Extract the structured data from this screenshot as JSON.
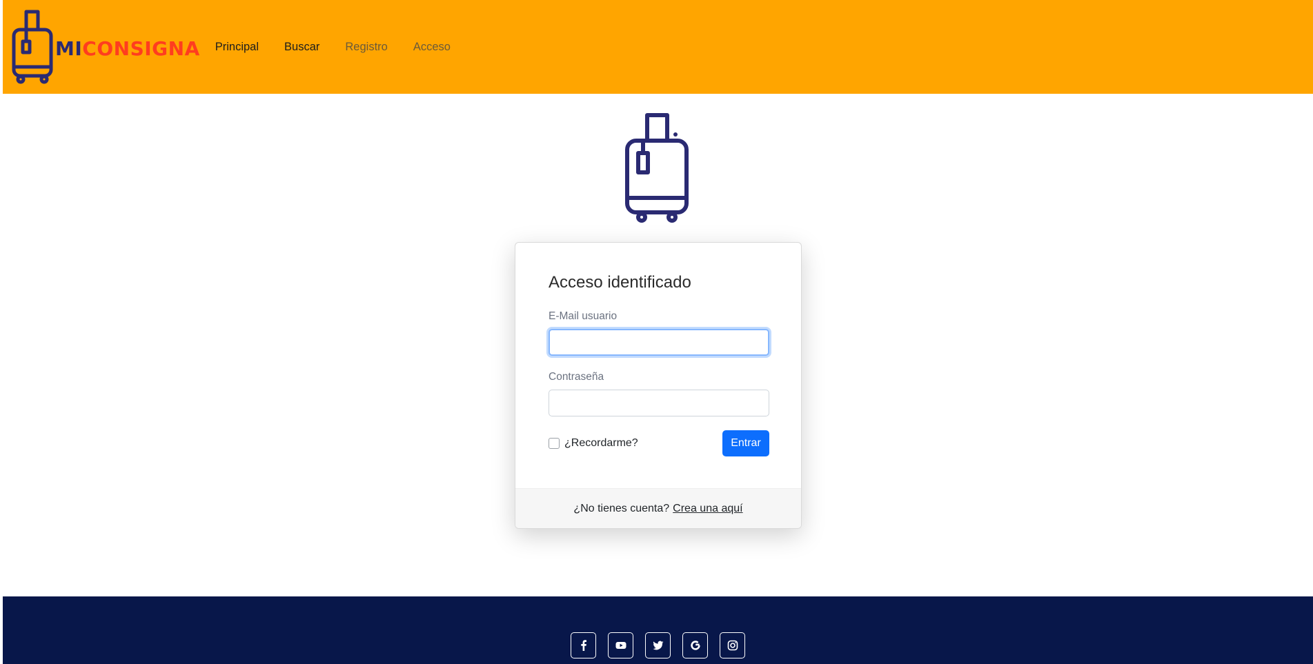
{
  "brand": {
    "prefix": "MI",
    "name": "CONSIGNA"
  },
  "nav": {
    "items": [
      {
        "label": "Principal"
      },
      {
        "label": "Buscar"
      },
      {
        "label": "Registro"
      },
      {
        "label": "Acceso"
      }
    ]
  },
  "login": {
    "title": "Acceso identificado",
    "email_label": "E-Mail usuario",
    "email_value": "",
    "password_label": "Contraseña",
    "password_value": "",
    "remember_label": "¿Recordarme?",
    "remember_checked": false,
    "submit_label": "Entrar"
  },
  "signup": {
    "prompt": "¿No tienes cuenta?",
    "link": "Crea una aquí"
  },
  "footer": {
    "social_icons": [
      "facebook-icon",
      "youtube-icon",
      "twitter-icon",
      "google-icon",
      "instagram-icon"
    ]
  },
  "colors": {
    "header_bg": "#ffa500",
    "brand_mi": "#2a2a72",
    "brand_consigna": "#ff3d1f",
    "footer_bg": "#08174a",
    "primary": "#0d6efd",
    "suitcase": "#2a2a72"
  }
}
